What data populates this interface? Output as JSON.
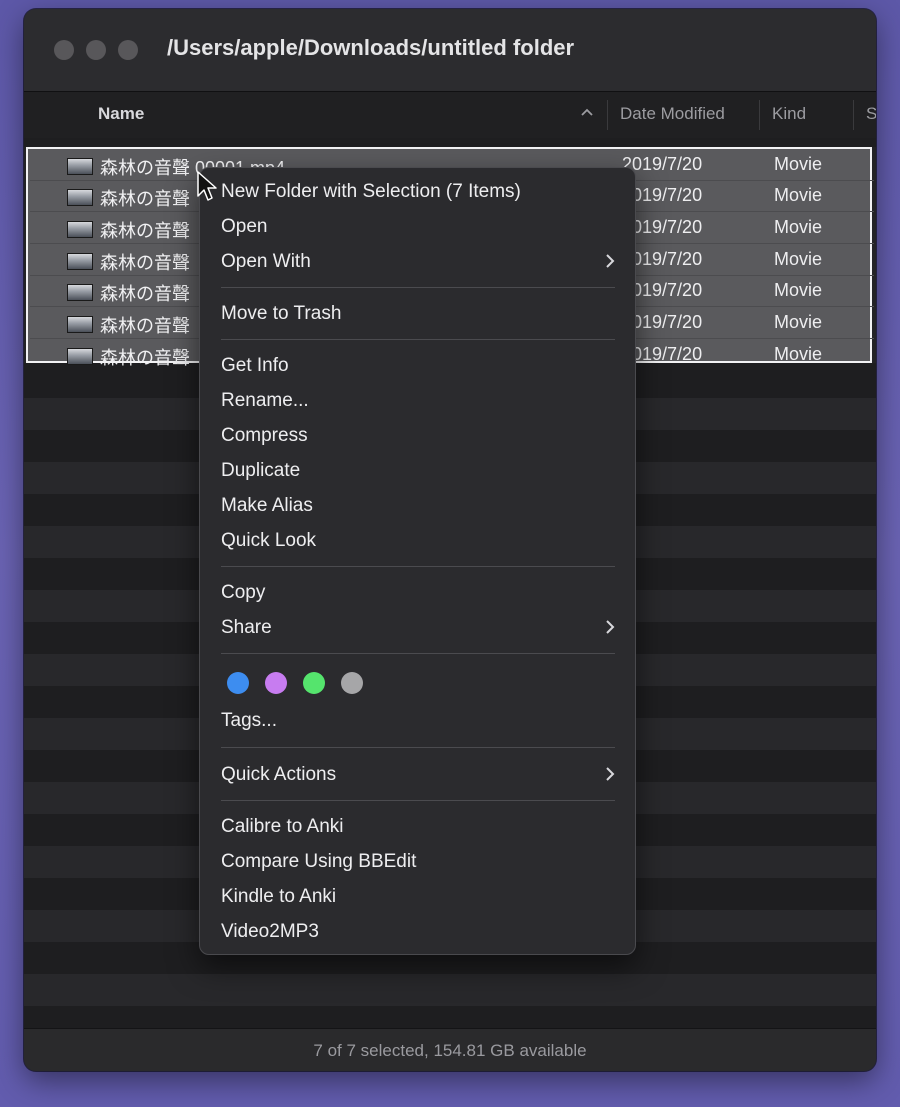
{
  "window": {
    "title": "/Users/apple/Downloads/untitled folder"
  },
  "columns": {
    "name": "Name",
    "date_modified": "Date Modified",
    "kind": "Kind",
    "size": "S"
  },
  "files": [
    {
      "name": "森林の音聲 00001.mp4",
      "date": "2019/7/20",
      "kind": "Movie"
    },
    {
      "name": "森林の音聲",
      "date": "2019/7/20",
      "kind": "Movie"
    },
    {
      "name": "森林の音聲",
      "date": "2019/7/20",
      "kind": "Movie"
    },
    {
      "name": "森林の音聲",
      "date": "2019/7/20",
      "kind": "Movie"
    },
    {
      "name": "森林の音聲",
      "date": "2019/7/20",
      "kind": "Movie"
    },
    {
      "name": "森林の音聲",
      "date": "2019/7/20",
      "kind": "Movie"
    },
    {
      "name": "森林の音聲",
      "date": "2019/7/20",
      "kind": "Movie"
    }
  ],
  "status": "7 of 7 selected, 154.81 GB available",
  "context_menu": {
    "new_folder": "New Folder with Selection (7 Items)",
    "open": "Open",
    "open_with": "Open With",
    "move_to_trash": "Move to Trash",
    "get_info": "Get Info",
    "rename": "Rename...",
    "compress": "Compress",
    "duplicate": "Duplicate",
    "make_alias": "Make Alias",
    "quick_look": "Quick Look",
    "copy": "Copy",
    "share": "Share",
    "tags": "Tags...",
    "quick_actions": "Quick Actions",
    "calibre_to_anki": "Calibre to Anki",
    "compare_bbedit": "Compare Using BBEdit",
    "kindle_to_anki": "Kindle to Anki",
    "video2mp3": "Video2MP3",
    "tag_colors": [
      "#3d8df0",
      "#c77cf0",
      "#55e46d",
      "#a6a6a8"
    ]
  },
  "colors": {
    "selection_fill": "#5a5a5d",
    "menu_bg": "#2b2b2e"
  }
}
